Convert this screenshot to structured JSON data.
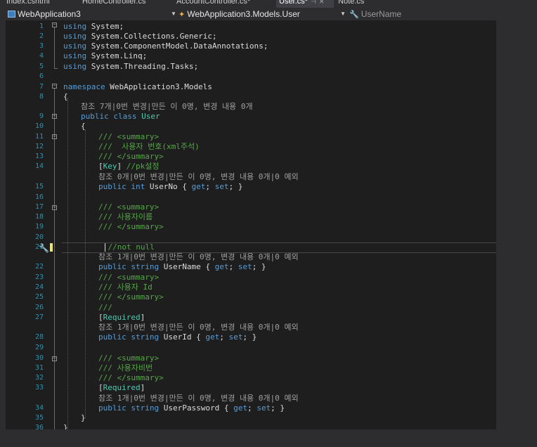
{
  "tabs": [
    {
      "label": "Index.cshtml",
      "active": false
    },
    {
      "label": "HomeController.cs",
      "active": false
    },
    {
      "label": "AccountController.cs*",
      "active": false
    },
    {
      "label": "User.cs*",
      "active": true
    },
    {
      "label": "Note.cs",
      "active": false
    }
  ],
  "tab_icons": {
    "pin": "⊣",
    "close": "✕"
  },
  "navbar": {
    "project": "WebApplication3",
    "class_path": "WebApplication3.Models.User",
    "member": "UserName"
  },
  "line_numbers": [
    "1",
    "2",
    "3",
    "4",
    "5",
    "6",
    "7",
    "8",
    "9",
    "10",
    "11",
    "12",
    "13",
    "14",
    "15",
    "16",
    "17",
    "18",
    "19",
    "20",
    "21",
    "22",
    "23",
    "24",
    "25",
    "26",
    "27",
    "28",
    "29",
    "30",
    "31",
    "32",
    "33",
    "34",
    "35",
    "36"
  ],
  "code": {
    "l1": [
      "using",
      " System;"
    ],
    "l2": [
      "using",
      " System.Collections.Generic;"
    ],
    "l3": [
      "using",
      " System.ComponentModel.DataAnnotations;"
    ],
    "l4": [
      "using",
      " System.Linq;"
    ],
    "l5": [
      "using",
      " System.Threading.Tasks;"
    ],
    "l7": [
      "namespace",
      " WebApplication3.Models"
    ],
    "brace_open": "{",
    "brace_close": "}",
    "lens_class": "참조 7개|0번 변경|만든 이 0명, 변경 내용 0개",
    "l9": [
      "public",
      " ",
      "class",
      " ",
      "User"
    ],
    "l11": "/// <summary>",
    "l12": "///  사용자 번호(xml주석)",
    "l13": "/// </summary>",
    "l14": [
      "[",
      "Key",
      "] ",
      "//pk설정"
    ],
    "lens_userno": "참조 0개|0번 변경|만든 이 0명, 변경 내용 0개|0 예외",
    "l15": [
      "public",
      " ",
      "int",
      " UserNo { ",
      "get",
      "; ",
      "set",
      "; }"
    ],
    "l17": "/// <summary>",
    "l18": "/// 사용자이름",
    "l19": "/// </summary>",
    "l21": "    //not null",
    "lens_username": "참조 1개|0번 변경|만든 이 0명, 변경 내용 0개|0 예외",
    "l22": [
      "public",
      " ",
      "string",
      " UserName { ",
      "get",
      "; ",
      "set",
      "; }"
    ],
    "l23": "/// <summary>",
    "l24": "/// 사용자 Id",
    "l25": "/// </summary>",
    "l26": "///",
    "l27": [
      "[",
      "Required",
      "]"
    ],
    "lens_userid": "참조 1개|0번 변경|만든 이 0명, 변경 내용 0개|0 예외",
    "l28": [
      "public",
      " ",
      "string",
      " UserId { ",
      "get",
      "; ",
      "set",
      "; }"
    ],
    "l30": "/// <summary>",
    "l31": "/// 사용자비번",
    "l32": "/// </summary>",
    "l33": [
      "[",
      "Required",
      "]"
    ],
    "lens_userpassword": "참조 1개|0번 변경|만든 이 0명, 변경 내용 0개|0 예외",
    "l34": [
      "public",
      " ",
      "string",
      " UserPassword { ",
      "get",
      "; ",
      "set",
      "; }"
    ]
  },
  "quick_action_icon": "lightbulb-screwdriver-icon",
  "colors": {
    "keyword": "#569cd6",
    "type": "#4ec9b0",
    "comment": "#57a64a",
    "line_number": "#2b91af",
    "change_marker": "#efe46b"
  }
}
